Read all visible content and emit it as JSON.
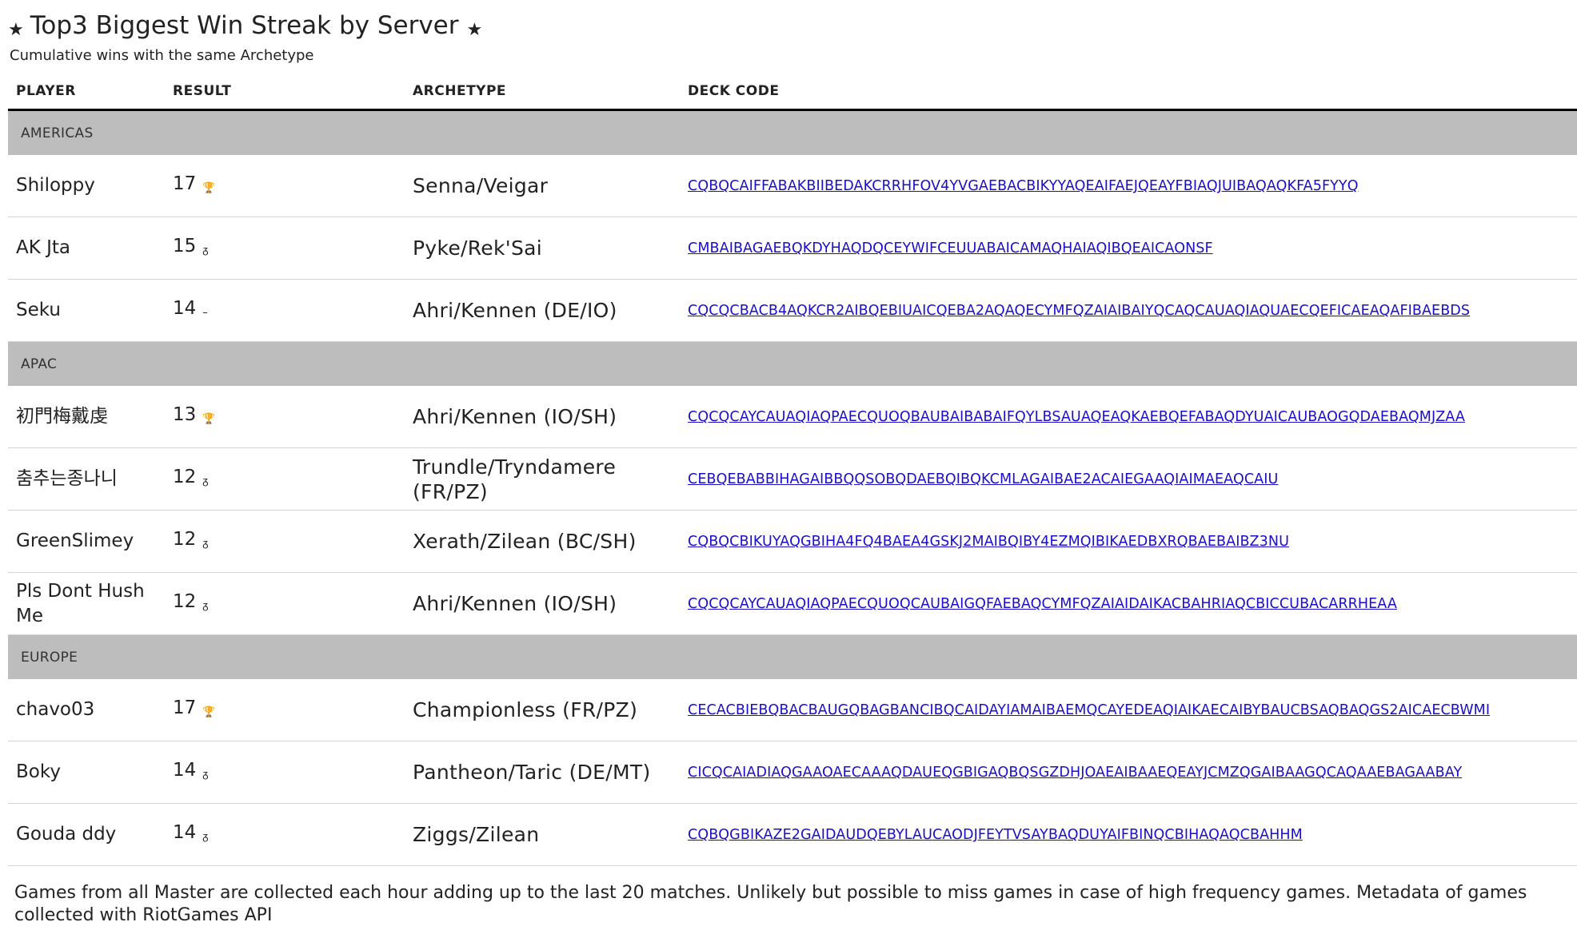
{
  "header": {
    "title": "Top3 Biggest Win Streak by Server",
    "subtitle": "Cumulative wins with the same Archetype",
    "star_glyph": "★"
  },
  "columns": {
    "player": "PLAYER",
    "result": "RESULT",
    "archetype": "ARCHETYPE",
    "deck_code": "DECK CODE"
  },
  "groups": [
    {
      "name": "AMERICAS",
      "rows": [
        {
          "player": "Shiloppy",
          "result": "17",
          "icon": "trophy-icon",
          "icon_glyph": "🏆",
          "archetype": "Senna/Veigar",
          "deck": "CQBQCAIFFABAKBIIBEDAKCRRHFOV4YVGAEBACBIKYYAQEAIFAEJQEAYFBIAQJUIBAQAQKFA5FYYQ"
        },
        {
          "player": "AK Jta",
          "result": "15",
          "icon": "medal-icon",
          "icon_glyph": "ᵹ",
          "archetype": "Pyke/Rek'Sai",
          "deck": "CMBAIBAGAEBQKDYHAQDQCEYWIFCEUUABAICAMAQHAIAQIBQEAICAONSF"
        },
        {
          "player": "Seku",
          "result": "14",
          "icon": "dash-icon",
          "icon_glyph": "–",
          "archetype": "Ahri/Kennen (DE/IO)",
          "deck": "CQCQCBACB4AQKCR2AIBQEBIUAICQEBA2AQAQECYMFQZAIAIBAIYQCAQCAUAQIAQUAECQEFICAEAQAFIBAEBDS"
        }
      ]
    },
    {
      "name": "APAC",
      "rows": [
        {
          "player": "初門梅戴虔",
          "result": "13",
          "icon": "trophy-icon",
          "icon_glyph": "🏆",
          "archetype": "Ahri/Kennen (IO/SH)",
          "deck": "CQCQCAYCAUAQIAQPAECQUOQBAUBAIBABAIFQYLBSAUAQEAQKAEBQEFABAQDYUAICAUBAOGQDAEBAQMJZAA"
        },
        {
          "player": "춤추는종나니",
          "result": "12",
          "icon": "medal-icon",
          "icon_glyph": "ᵹ",
          "archetype": "Trundle/Tryndamere (FR/PZ)",
          "deck": "CEBQEBABBIHAGAIBBQQSOBQDAEBQIBQKCMLAGAIBAE2ACAIEGAAQIAIMAEAQCAIU"
        },
        {
          "player": "GreenSlimey",
          "result": "12",
          "icon": "medal-icon",
          "icon_glyph": "ᵹ",
          "archetype": "Xerath/Zilean (BC/SH)",
          "deck": "CQBQCBIKUYAQGBIHA4FQ4BAEA4GSKJ2MAIBQIBY4EZMQIBIKAEDBXRQBAEBAIBZ3NU"
        },
        {
          "player": "Pls Dont Hush Me",
          "result": "12",
          "icon": "medal-icon",
          "icon_glyph": "ᵹ",
          "archetype": "Ahri/Kennen (IO/SH)",
          "deck": "CQCQCAYCAUAQIAQPAECQUOQCAUBAIGQFAEBAQCYMFQZAIAIDAIKACBAHRIAQCBICCUBACARRHEAA"
        }
      ]
    },
    {
      "name": "EUROPE",
      "rows": [
        {
          "player": "chavo03",
          "result": "17",
          "icon": "trophy-icon",
          "icon_glyph": "🏆",
          "archetype": "Championless (FR/PZ)",
          "deck": "CECACBIEBQBACBAUGQBAGBANCIBQCAIDAYIAMAIBAEMQCAYEDEAQIAIKAECAIBYBAUCBSAQBAQGS2AICAECBWMI"
        },
        {
          "player": "Boky",
          "result": "14",
          "icon": "medal-icon",
          "icon_glyph": "ᵹ",
          "archetype": "Pantheon/Taric (DE/MT)",
          "deck": "CICQCAIADIAQGAAOAECAAAQDAUEQGBIGAQBQSGZDHJOAEAIBAAEQEAYJCMZQGAIBAAGQCAQAAEBAGAABAY"
        },
        {
          "player": "Gouda ddy",
          "result": "14",
          "icon": "medal-icon",
          "icon_glyph": "ᵹ",
          "archetype": "Ziggs/Zilean",
          "deck": "CQBQGBIKAZE2GAIDAUDQEBYLAUCAODJFEYTVSAYBAQDUYAIFBINQCBIHAQAQCBAHHM"
        }
      ]
    }
  ],
  "footer": "Games from all Master are collected each hour adding up to the last 20 matches. Unlikely but possible to miss games in case of high frequency games. Metadata of games collected with RiotGames API"
}
